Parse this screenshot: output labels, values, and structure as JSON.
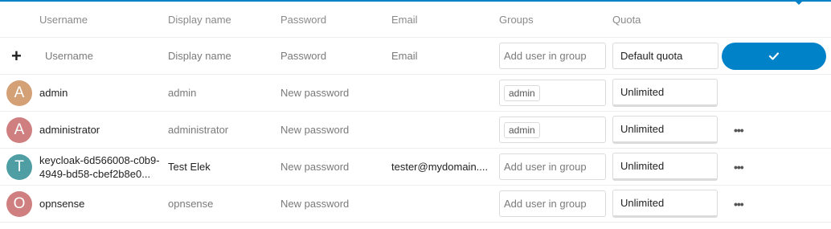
{
  "header": {
    "username": "Username",
    "display_name": "Display name",
    "password": "Password",
    "email": "Email",
    "groups": "Groups",
    "quota": "Quota"
  },
  "new_user": {
    "add_icon": "plus-icon",
    "username_placeholder": "Username",
    "display_name_placeholder": "Display name",
    "password_placeholder": "Password",
    "email_placeholder": "Email",
    "groups_placeholder": "Add user in group",
    "quota_value": "Default quota",
    "confirm_icon": "checkmark-icon"
  },
  "users": [
    {
      "initial": "A",
      "avatar_color": "#d4a076",
      "username": "admin",
      "display_name": "admin",
      "password_placeholder": "New password",
      "email": "",
      "group_tag": "admin",
      "groups_placeholder": "",
      "quota": "Unlimited"
    },
    {
      "initial": "A",
      "avatar_color": "#cf7f7f",
      "username": "administrator",
      "display_name": "administrator",
      "password_placeholder": "New password",
      "email": "",
      "group_tag": "admin",
      "groups_placeholder": "",
      "quota": "Unlimited"
    },
    {
      "initial": "T",
      "avatar_color": "#4e9ea4",
      "username": "keycloak-6d566008-c0b9-4949-bd58-cbef2b8e0...",
      "display_name": "Test Elek",
      "password_placeholder": "New password",
      "email": "tester@mydomain....",
      "group_tag": "",
      "groups_placeholder": "Add user in group",
      "quota": "Unlimited"
    },
    {
      "initial": "O",
      "avatar_color": "#cf7f7f",
      "username": "opnsense",
      "display_name": "opnsense",
      "password_placeholder": "New password",
      "email": "",
      "group_tag": "",
      "groups_placeholder": "Add user in group",
      "quota": "Unlimited"
    }
  ],
  "colors": {
    "accent": "#0082c9"
  }
}
